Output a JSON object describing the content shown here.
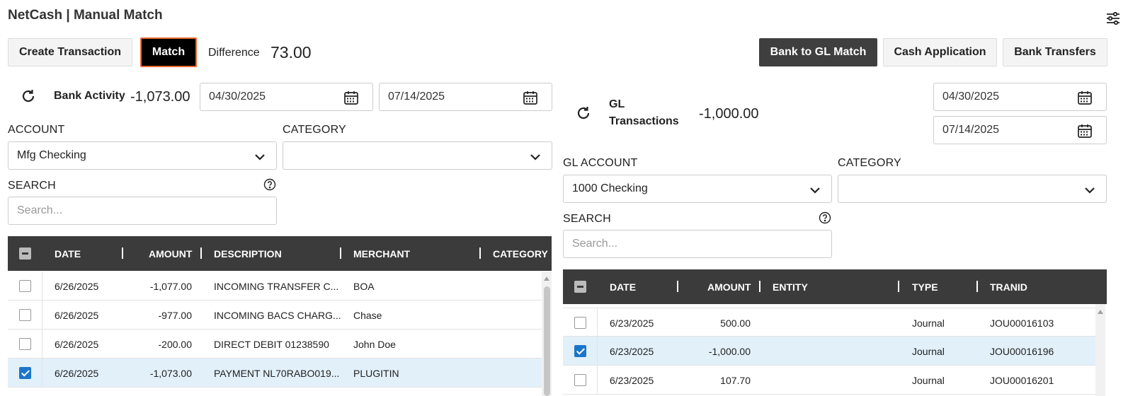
{
  "page": {
    "title": "NetCash | Manual Match"
  },
  "toolbar": {
    "create_label": "Create Transaction",
    "match_label": "Match",
    "difference_label": "Difference",
    "difference_value": "73.00",
    "bank_gl_label": "Bank to GL Match",
    "cash_app_label": "Cash Application",
    "bank_transfers_label": "Bank Transfers"
  },
  "bank": {
    "title": "Bank Activity",
    "total": "-1,073.00",
    "date_from": "04/30/2025",
    "date_to": "07/14/2025",
    "account_label": "ACCOUNT",
    "account_value": "Mfg Checking",
    "category_label": "CATEGORY",
    "category_value": "",
    "search_label": "SEARCH",
    "search_placeholder": "Search...",
    "columns": [
      "DATE",
      "AMOUNT",
      "DESCRIPTION",
      "MERCHANT",
      "CATEGORY"
    ],
    "rows": [
      {
        "checked": false,
        "date": "6/26/2025",
        "amount": "-1,077.00",
        "description": "INCOMING TRANSFER C...",
        "merchant": "BOA"
      },
      {
        "checked": false,
        "date": "6/26/2025",
        "amount": "-977.00",
        "description": "INCOMING BACS CHARG...",
        "merchant": "Chase"
      },
      {
        "checked": false,
        "date": "6/26/2025",
        "amount": "-200.00",
        "description": "DIRECT DEBIT 01238590",
        "merchant": "John Doe"
      },
      {
        "checked": true,
        "date": "6/26/2025",
        "amount": "-1,073.00",
        "description": "PAYMENT NL70RABO019...",
        "merchant": "PLUGITIN"
      }
    ]
  },
  "gl": {
    "title_line1": "GL",
    "title_line2": "Transactions",
    "total": "-1,000.00",
    "date_from": "04/30/2025",
    "date_to": "07/14/2025",
    "account_label": "GL ACCOUNT",
    "account_value": "1000 Checking",
    "category_label": "CATEGORY",
    "category_value": "",
    "search_label": "SEARCH",
    "search_placeholder": "Search...",
    "columns": [
      "DATE",
      "AMOUNT",
      "ENTITY",
      "TYPE",
      "TRANID"
    ],
    "rows": [
      {
        "checked": false,
        "date": "6/23/2025",
        "amount": "500.00",
        "entity": "",
        "type": "Journal",
        "tranid": "JOU00016103"
      },
      {
        "checked": true,
        "date": "6/23/2025",
        "amount": "-1,000.00",
        "entity": "",
        "type": "Journal",
        "tranid": "JOU00016196"
      },
      {
        "checked": false,
        "date": "6/23/2025",
        "amount": "107.70",
        "entity": "",
        "type": "Journal",
        "tranid": "JOU00016201"
      }
    ]
  },
  "icons": {
    "settings": "sliders-icon",
    "refresh": "refresh-icon",
    "calendar": "calendar-icon",
    "chevron": "chevron-down-icon",
    "help": "help-circle-icon"
  },
  "colors": {
    "header_bg": "#3b3b3b",
    "selected_row": "#e2f0fa",
    "checkbox_on": "#1b76c8",
    "match_border": "#e8692b"
  }
}
